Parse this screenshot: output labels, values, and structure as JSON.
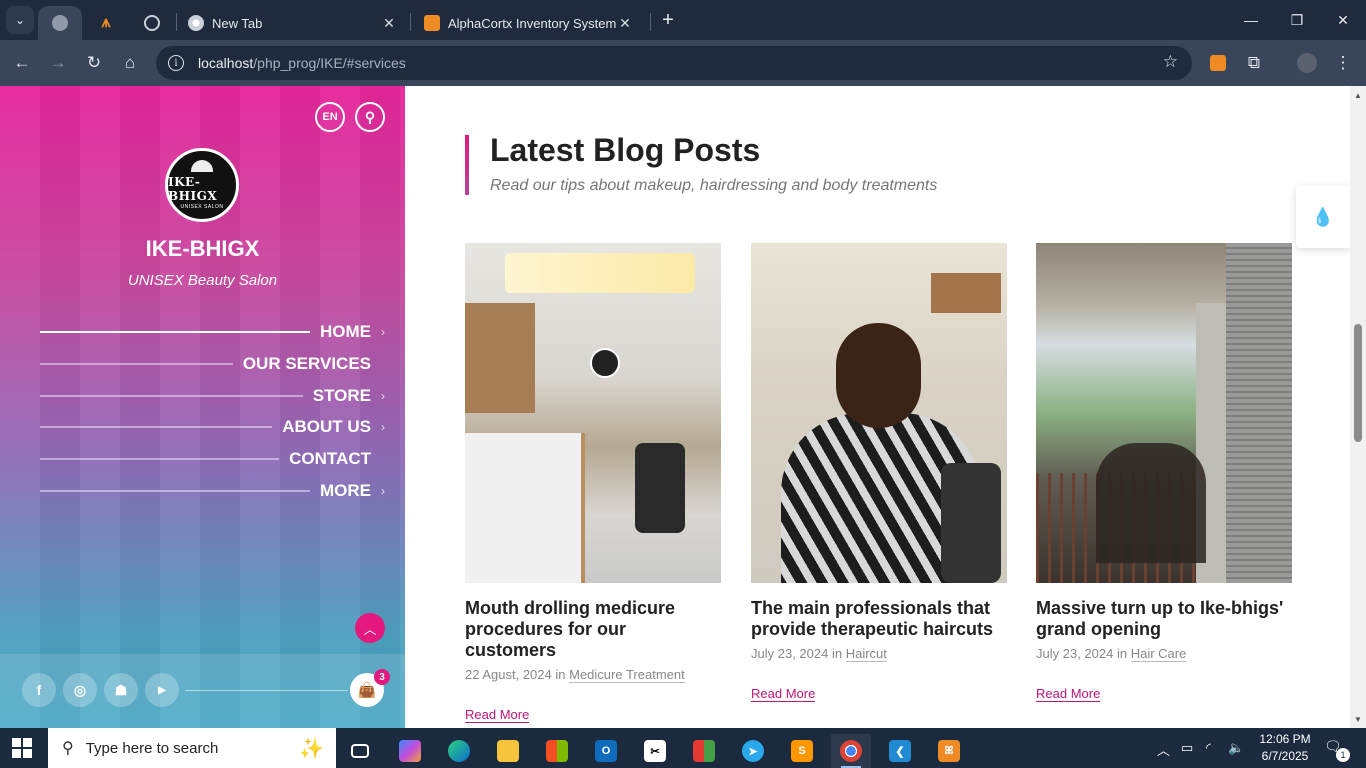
{
  "browser": {
    "tabs": [
      {
        "label": "",
        "icon": "globe-icon",
        "pinned": true
      },
      {
        "label": "",
        "icon": "xampp-logo-icon",
        "pinned": true
      },
      {
        "label": "",
        "icon": "globe-icon",
        "pinned": true
      },
      {
        "label": "New Tab",
        "icon": "chrome-icon"
      },
      {
        "label": "AlphaCortx Inventory System",
        "icon": "xampp-icon"
      }
    ],
    "url_host": "localhost",
    "url_path": "/php_prog/IKE/#services",
    "window_controls": {
      "minimize": "—",
      "restore": "❐",
      "close": "✕"
    }
  },
  "sidebar": {
    "lang_label": "EN",
    "logo_word": "IKE-BHIGX",
    "logo_sub": "UNISEX SALON",
    "brand_name": "IKE-BHIGX",
    "brand_tagline": "UNISEX Beauty Salon",
    "nav": [
      {
        "label": "HOME",
        "has_children": true,
        "active": true
      },
      {
        "label": "OUR SERVICES",
        "has_children": false
      },
      {
        "label": "STORE",
        "has_children": true
      },
      {
        "label": "ABOUT US",
        "has_children": true
      },
      {
        "label": "CONTACT",
        "has_children": false
      },
      {
        "label": "MORE",
        "has_children": true
      }
    ],
    "social": [
      "facebook-icon",
      "instagram-icon",
      "snapchat-icon",
      "youtube-icon"
    ],
    "cart_count": "3"
  },
  "main": {
    "section_title": "Latest Blog Posts",
    "section_subtitle": "Read our tips about makeup, hairdressing and body treatments",
    "posts": [
      {
        "title": "Mouth drolling medicure procedures for our customers",
        "date": "22 Agust, 2024",
        "in": "in",
        "category": "Medicure Treatment",
        "read_more": "Read More"
      },
      {
        "title": "The main professionals that provide therapeutic haircuts",
        "date": "July 23, 2024",
        "in": "in",
        "category": "Haircut",
        "read_more": "Read More"
      },
      {
        "title": "Massive turn up to Ike-bhigs' grand opening",
        "date": "July 23, 2024",
        "in": "in",
        "category": "Hair Care",
        "read_more": "Read More"
      }
    ]
  },
  "taskbar": {
    "search_placeholder": "Type here to search",
    "time": "12:06 PM",
    "date": "6/7/2025",
    "notification_count": "1"
  },
  "colors": {
    "accent": "#e4197d",
    "browser_dark": "#1f2b3d",
    "taskbar": "#1c2a3f"
  }
}
